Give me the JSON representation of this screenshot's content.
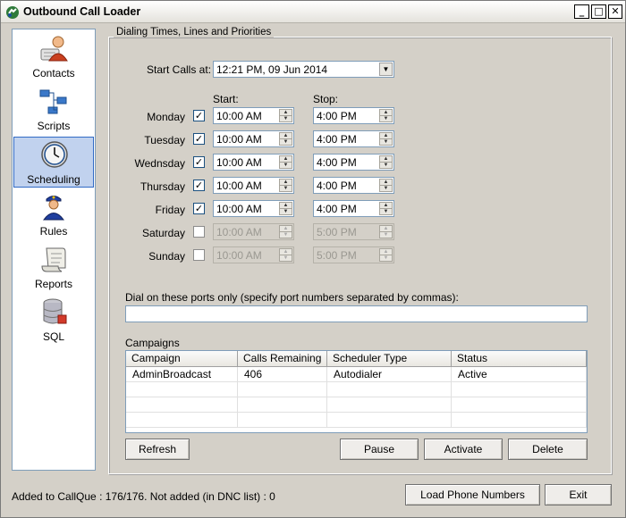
{
  "window": {
    "title": "Outbound Call Loader"
  },
  "sidebar": {
    "items": [
      {
        "label": "Contacts",
        "icon": "contacts-icon"
      },
      {
        "label": "Scripts",
        "icon": "scripts-icon"
      },
      {
        "label": "Scheduling",
        "icon": "clock-icon",
        "selected": true
      },
      {
        "label": "Rules",
        "icon": "officer-icon"
      },
      {
        "label": "Reports",
        "icon": "scroll-icon"
      },
      {
        "label": "SQL",
        "icon": "database-icon"
      }
    ]
  },
  "group": {
    "title": "Dialing Times, Lines and Priorities",
    "start_calls_label": "Start Calls at:",
    "start_calls_value": "12:21 PM, 09 Jun  2014",
    "start_header": "Start:",
    "stop_header": "Stop:",
    "days": [
      {
        "name": "Monday",
        "checked": true,
        "start": "10:00 AM",
        "stop": "4:00 PM"
      },
      {
        "name": "Tuesday",
        "checked": true,
        "start": "10:00 AM",
        "stop": "4:00 PM"
      },
      {
        "name": "Wednsday",
        "checked": true,
        "start": "10:00 AM",
        "stop": "4:00 PM"
      },
      {
        "name": "Thursday",
        "checked": true,
        "start": "10:00 AM",
        "stop": "4:00 PM"
      },
      {
        "name": "Friday",
        "checked": true,
        "start": "10:00 AM",
        "stop": "4:00 PM"
      },
      {
        "name": "Saturday",
        "checked": false,
        "start": "10:00 AM",
        "stop": "5:00 PM"
      },
      {
        "name": "Sunday",
        "checked": false,
        "start": "10:00 AM",
        "stop": "5:00 PM"
      }
    ],
    "ports_label": "Dial on these ports only (specify port numbers separated by commas):",
    "ports_value": "",
    "campaigns_label": "Campaigns",
    "campaigns": {
      "columns": [
        "Campaign",
        "Calls Remaining",
        "Scheduler Type",
        "Status"
      ],
      "rows": [
        [
          "AdminBroadcast",
          "406",
          "Autodialer",
          "Active"
        ]
      ]
    },
    "buttons": {
      "refresh": "Refresh",
      "pause": "Pause",
      "activate": "Activate",
      "delete": "Delete"
    }
  },
  "footer": {
    "status": "Added to CallQue : 176/176. Not added (in DNC list) : 0",
    "load_button": "Load Phone Numbers",
    "exit_button": "Exit"
  },
  "colors": {
    "window_bg": "#d4d0c8",
    "selection_bg": "#c1d2ee",
    "selection_border": "#316ac5"
  }
}
